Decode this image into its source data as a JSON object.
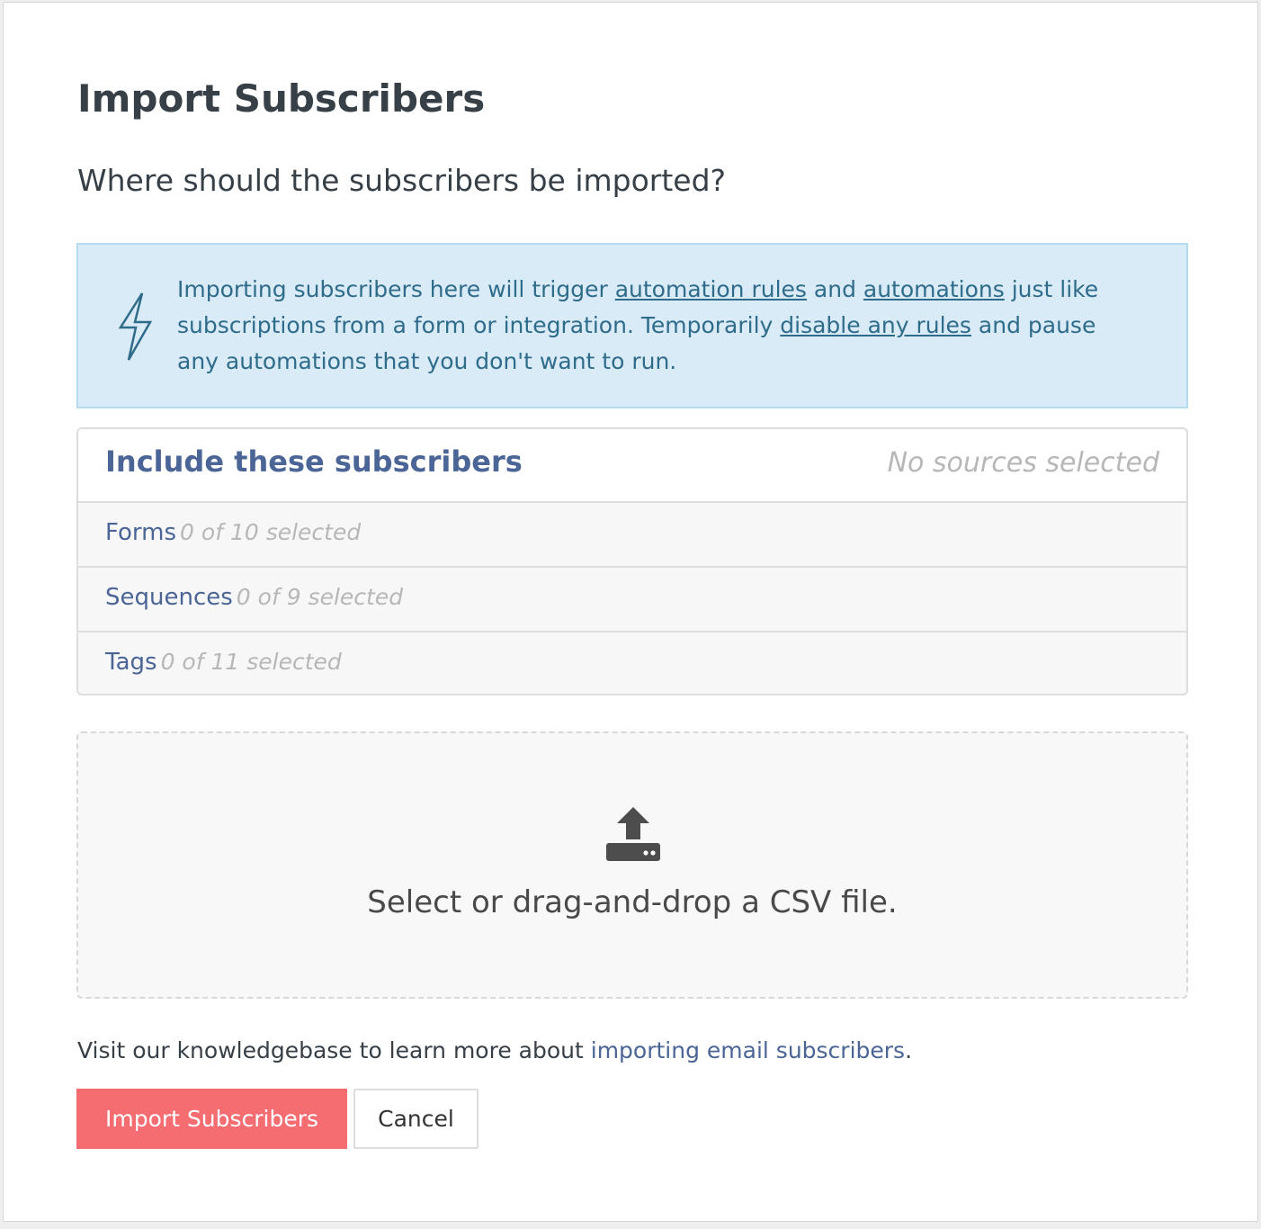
{
  "modal": {
    "title": "Import Subscribers",
    "question": "Where should the subscribers be imported?"
  },
  "info": {
    "icon": "lightning-bolt-icon",
    "text_1": "Importing subscribers here will trigger ",
    "link_automation_rules": "automation rules",
    "text_2": " and ",
    "link_automations": "automations",
    "text_3": " just like",
    "text_4": "subscriptions from a form or integration. Temporarily ",
    "link_disable_rules": "disable any rules",
    "text_5": " and pause",
    "text_6": "any automations that you don't want to run."
  },
  "sources": {
    "title": "Include these subscribers",
    "status": "No sources selected",
    "rows": [
      {
        "label": "Forms",
        "count": "0 of 10 selected"
      },
      {
        "label": "Sequences",
        "count": "0 of 9 selected"
      },
      {
        "label": "Tags",
        "count": "0 of 11 selected"
      }
    ]
  },
  "dropzone": {
    "icon": "upload-icon",
    "text": "Select or drag-and-drop a CSV file."
  },
  "knowledgebase": {
    "text": "Visit our knowledgebase to learn more about ",
    "link": "importing email subscribers",
    "period": "."
  },
  "actions": {
    "import_label": "Import Subscribers",
    "cancel_label": "Cancel"
  },
  "colors": {
    "primary_button": "#f56c71",
    "info_background": "#d9ebf6",
    "link": "#4a6596"
  }
}
